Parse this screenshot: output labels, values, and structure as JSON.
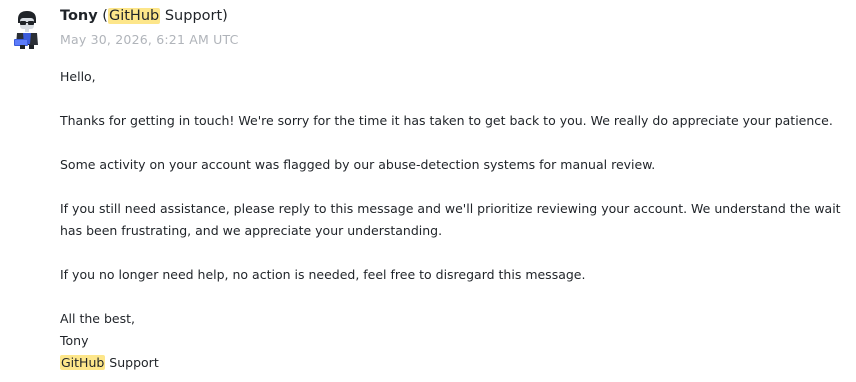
{
  "sender": {
    "name": "Tony",
    "paren_open": " (",
    "org_highlight": "GitHub",
    "org_rest": " Support",
    "paren_close": ")"
  },
  "timestamp": "May 30, 2026, 6:21 AM UTC",
  "avatar": {
    "icon": "hacker-avatar-icon",
    "colors": [
      "#1f2328",
      "#3b5bdb",
      "#d8dde3"
    ]
  },
  "highlight_color": "#fde68a",
  "message": {
    "greeting": "Hello,",
    "paragraphs": [
      "Thanks for getting in touch! We're sorry for the time it has taken to get back to you. We really do appreciate your patience.",
      "Some activity on your account was flagged by our abuse-detection systems for manual review.",
      "If you still need assistance, please reply to this message and we'll prioritize reviewing your account. We understand the wait has been frustrating, and we appreciate your understanding.",
      "If you no longer need help, no action is needed, feel free to disregard this message."
    ],
    "signoff": "All the best,",
    "signature_name": "Tony",
    "signature_org_highlight": "GitHub",
    "signature_org_rest": " Support"
  }
}
